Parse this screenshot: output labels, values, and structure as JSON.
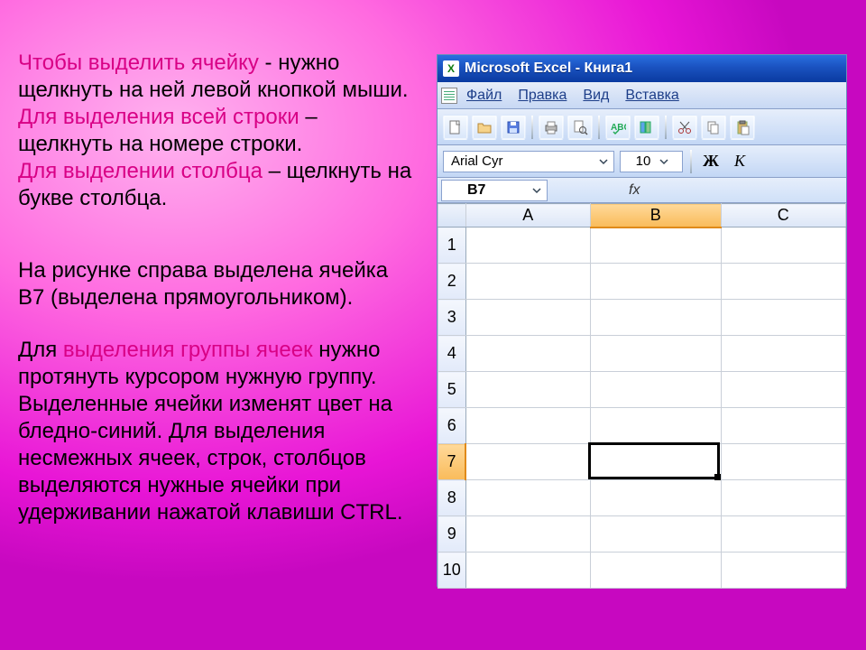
{
  "text": {
    "p1a": "Чтобы выделить ячейку",
    "p1b": "  -  нужно щелкнуть на ней левой кнопкой мыши.",
    "p2a": "Для выделения всей строки",
    "p2b": " – щелкнуть на номере строки.",
    "p3a": "Для выделении столбца",
    "p3b": " – щелкнуть на букве столбца.",
    "p4": "На рисунке справа выделена ячейка B7 (выделена прямоугольником).",
    "p5a": "Для ",
    "p5b": "выделения группы ячеек",
    "p5c": " нужно протянуть курсором нужную группу. Выделенные ячейки изменят цвет на бледно-синий. Для выделения несмежных ячеек, строк, столбцов выделяются нужные ячейки при удерживании нажатой клавиши CTRL."
  },
  "excel": {
    "title": "Microsoft Excel - Книга1",
    "menu": [
      "Файл",
      "Правка",
      "Вид",
      "Вставка"
    ],
    "font_name": "Arial Cyr",
    "font_size": "10",
    "bold": "Ж",
    "italic": "К",
    "namebox": "B7",
    "fx": "fx",
    "columns": [
      "A",
      "B",
      "C"
    ],
    "rows": [
      "1",
      "2",
      "3",
      "4",
      "5",
      "6",
      "7",
      "8",
      "9",
      "10"
    ],
    "selected_col": "B",
    "selected_row": "7"
  }
}
